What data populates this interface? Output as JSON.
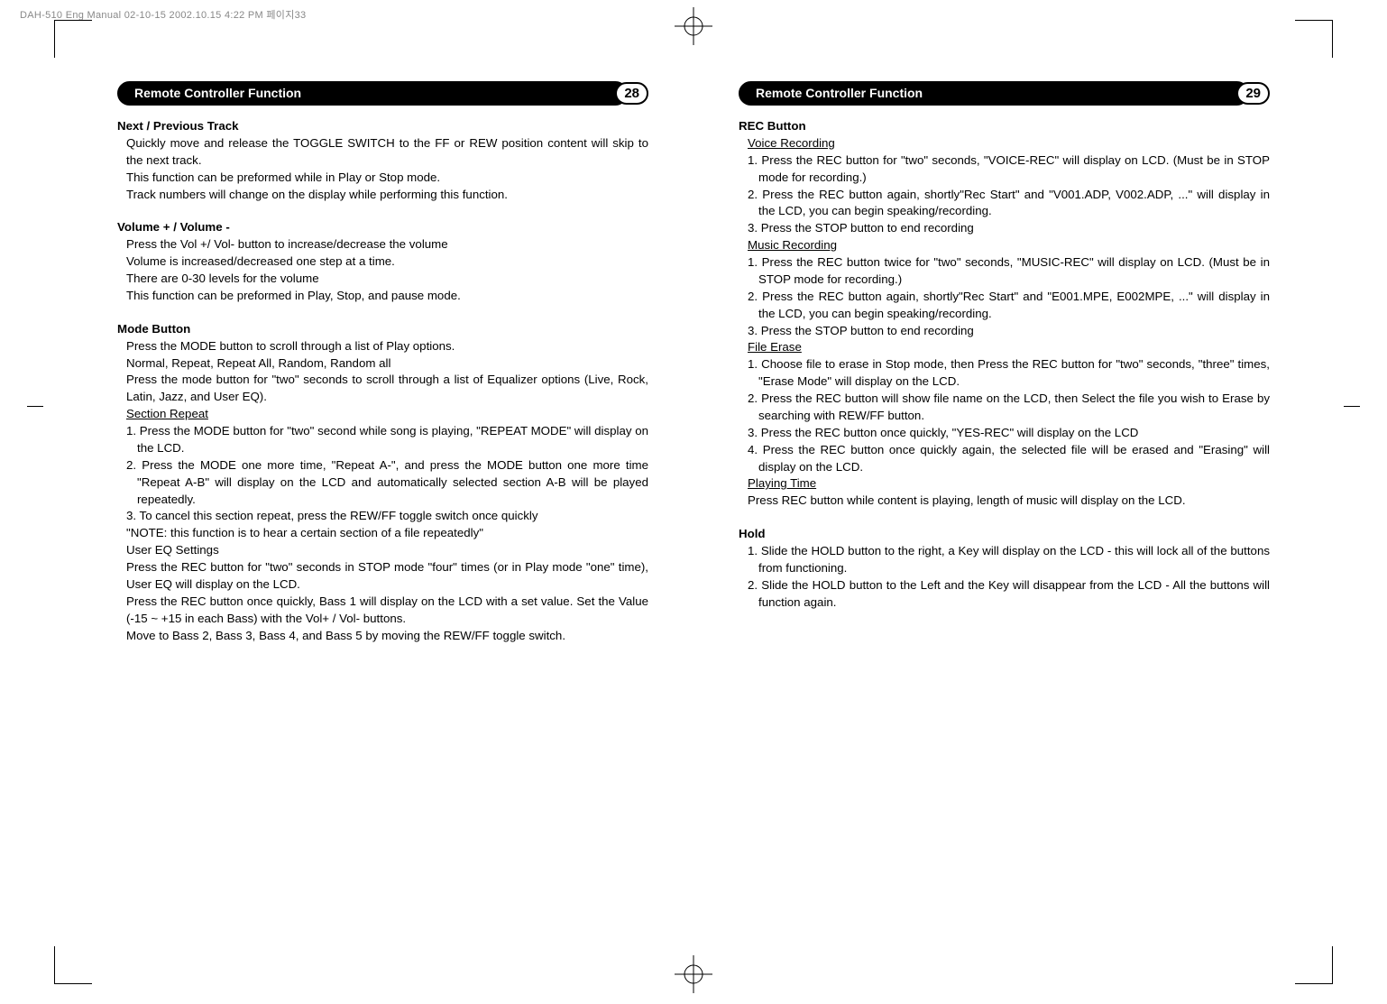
{
  "header": "DAH-510 Eng Manual 02-10-15  2002.10.15 4:22 PM  페이지33",
  "left": {
    "title": "Remote Controller Function",
    "page_num": "28",
    "s1_title": "Next / Previous Track",
    "s1_p1": "Quickly move and release the TOGGLE SWITCH to the FF or REW position content will skip to the next track.",
    "s1_p2": "This function can be preformed while in Play or Stop mode.",
    "s1_p3": "Track numbers will change on the display while performing this function.",
    "s2_title": "Volume + / Volume -",
    "s2_p1": "Press the Vol +/ Vol- button to increase/decrease the volume",
    "s2_p2": "Volume is increased/decreased one step at a time.",
    "s2_p3": "There are 0-30 levels for the volume",
    "s2_p4": "This function can be preformed in Play, Stop, and pause mode.",
    "s3_title": "Mode Button",
    "s3_p1": "Press the MODE button to scroll through a list of Play options.",
    "s3_p2": "Normal, Repeat, Repeat All, Random, Random all",
    "s3_p3": "Press the mode button for \"two\" seconds to scroll through a list of Equalizer options (Live, Rock, Latin, Jazz, and User EQ).",
    "s3_sub1": "Section Repeat",
    "s3_p4": "1. Press the MODE button for \"two\" second while song is playing, \"REPEAT MODE\" will display on the LCD.",
    "s3_p5": "2. Press the MODE one more time, \"Repeat A-\", and press the MODE button one more time \"Repeat A-B\" will display on the LCD and automatically selected section A-B will be played repeatedly.",
    "s3_p6": "3. To cancel this section repeat, press the REW/FF toggle switch once quickly",
    "s3_p7": "\"NOTE: this function is to hear a certain section of a file repeatedly\"",
    "s3_sub2": "User EQ Settings",
    "s3_p8": "Press the REC button for \"two\" seconds in STOP mode \"four\" times (or in Play mode \"one\" time), User EQ will display on the LCD.",
    "s3_p9": "Press the REC button once quickly, Bass 1 will display on the LCD with a set value. Set the Value (-15 ~ +15 in each Bass) with the Vol+ / Vol- buttons.",
    "s3_p10": "Move to Bass 2, Bass 3, Bass 4, and Bass 5 by moving the REW/FF toggle switch."
  },
  "right": {
    "title": "Remote Controller Function",
    "page_num": "29",
    "s1_title": "REC Button",
    "s1_sub1": "Voice Recording",
    "s1_p1": "1. Press the REC button for \"two\" seconds, \"VOICE-REC\" will display on LCD.  (Must be in STOP mode for recording.)",
    "s1_p2": "2. Press the REC button again, shortly\"Rec Start\" and \"V001.ADP, V002.ADP, ...\" will display in the LCD, you can begin speaking/recording.",
    "s1_p3": "3. Press the STOP button to end recording",
    "s1_sub2": "Music Recording",
    "s1_p4": "1. Press the REC button twice for \"two\" seconds, \"MUSIC-REC\" will display on LCD. (Must be in STOP mode for recording.)",
    "s1_p5": "2. Press the REC button again, shortly\"Rec Start\" and \"E001.MPE, E002MPE, ...\" will display in the LCD, you can begin speaking/recording.",
    "s1_p6": "3. Press the STOP button to end recording",
    "s1_sub3": "File Erase",
    "s1_p7": "1. Choose file to erase in Stop mode, then Press the REC button for \"two\" seconds, \"three\" times, \"Erase Mode\" will display on the LCD.",
    "s1_p8": "2. Press the REC button will show file name on the LCD, then Select the file you wish to Erase by searching with REW/FF button.",
    "s1_p9": "3. Press the REC button once quickly, \"YES-REC\" will display on the LCD",
    "s1_p10": "4. Press the REC button once quickly again, the selected file will be erased and \"Erasing\" will display on the LCD.",
    "s1_sub4": "Playing Time",
    "s1_p11": "Press REC button while content is playing, length of music will display on the LCD.",
    "s2_title": "Hold",
    "s2_p1": "1. Slide the HOLD button to the right, a Key will display on the LCD - this will lock all of the buttons from functioning.",
    "s2_p2": "2. Slide the HOLD button to the Left and the Key will disappear from the LCD - All the buttons will function again."
  }
}
